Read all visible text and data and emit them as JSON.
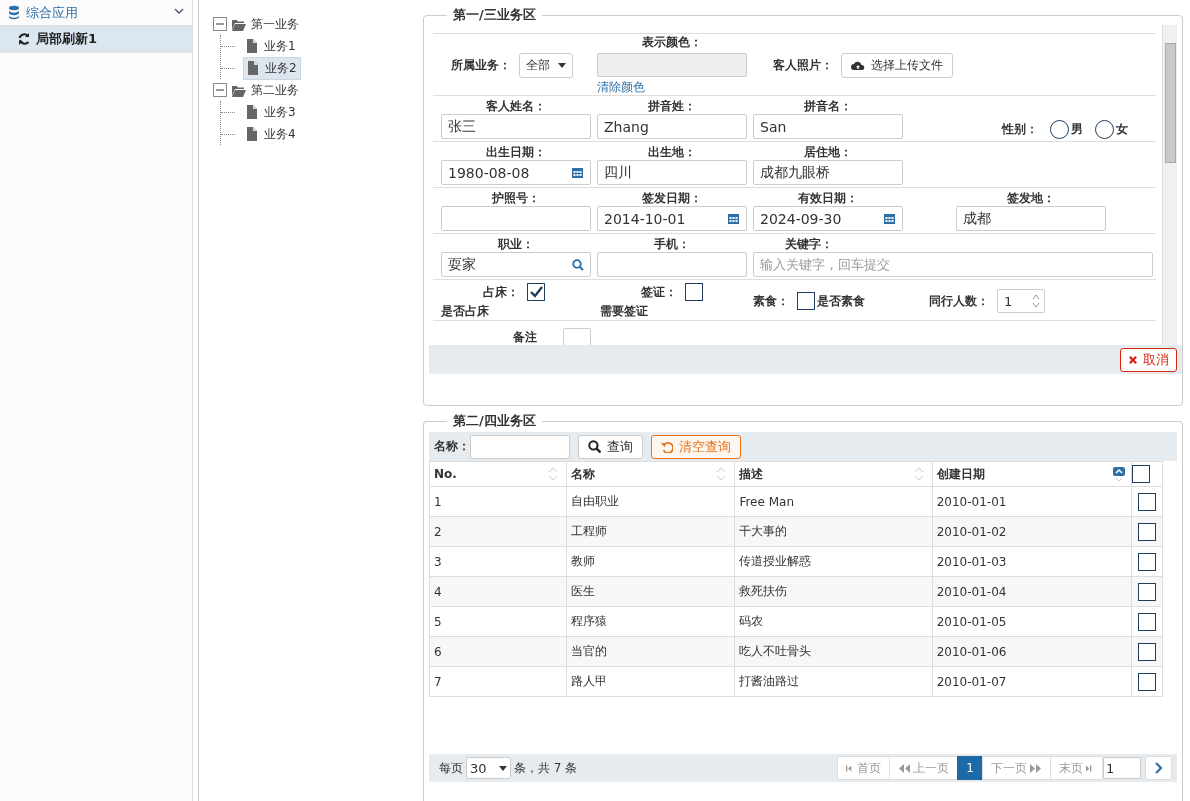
{
  "sidebar": {
    "header": {
      "label": "综合应用",
      "expanded": true
    },
    "items": [
      {
        "label": "局部刷新1",
        "selected": true
      }
    ]
  },
  "tree": [
    {
      "label": "第一业务",
      "expanded": true,
      "children": [
        {
          "label": "业务1",
          "selected": false
        },
        {
          "label": "业务2",
          "selected": true
        }
      ]
    },
    {
      "label": "第二业务",
      "expanded": true,
      "children": [
        {
          "label": "业务3",
          "selected": false
        },
        {
          "label": "业务4",
          "selected": false
        }
      ]
    }
  ],
  "form_panel": {
    "title": "第一/三业务区",
    "rows": [
      [
        {
          "kind": "select",
          "label": "所属业务：",
          "value": "全部"
        },
        {
          "kind": "color",
          "label": "表示颜色：",
          "link": "清除颜色"
        },
        {
          "kind": "file",
          "label": "客人照片：",
          "button": "选择上传文件"
        }
      ],
      [
        {
          "kind": "text",
          "label": "客人姓名：",
          "value": "张三"
        },
        {
          "kind": "text",
          "label": "拼音姓：",
          "value": "Zhang"
        },
        {
          "kind": "text",
          "label": "拼音名：",
          "value": "San"
        },
        {
          "kind": "radio",
          "label": "性别：",
          "options": [
            {
              "label": "男",
              "selected": false
            },
            {
              "label": "女",
              "selected": false
            }
          ]
        }
      ],
      [
        {
          "kind": "date",
          "label": "出生日期：",
          "value": "1980-08-08"
        },
        {
          "kind": "text",
          "label": "出生地：",
          "value": "四川"
        },
        {
          "kind": "text",
          "label": "居住地：",
          "value": "成都九眼桥"
        }
      ],
      [
        {
          "kind": "text",
          "label": "护照号："
        },
        {
          "kind": "date",
          "label": "签发日期：",
          "value": "2014-10-01"
        },
        {
          "kind": "date",
          "label": "有效日期：",
          "value": "2024-09-30"
        },
        {
          "kind": "text",
          "label": "签发地：",
          "value": "成都"
        }
      ],
      [
        {
          "kind": "search",
          "label": "职业：",
          "value": "耍家"
        },
        {
          "kind": "text",
          "label": "手机："
        },
        {
          "kind": "wide",
          "label": "关键字：",
          "placeholder": "输入关键字，回车提交"
        }
      ],
      [
        {
          "kind": "checkbox",
          "label": "占床：",
          "checked": true,
          "caption": "是否占床"
        },
        {
          "kind": "checkbox",
          "label": "签证：",
          "checked": false,
          "caption": "需要签证"
        },
        {
          "kind": "checkbox",
          "label": "素食：",
          "checked": false,
          "text": "是否素食"
        },
        {
          "kind": "spinner",
          "label": "同行人数：",
          "value": "1"
        }
      ],
      [
        {
          "kind": "textarea",
          "label": "备注"
        }
      ]
    ],
    "cancel_button": "取消"
  },
  "grid_panel": {
    "title": "第二/四业务区",
    "search": {
      "label": "名称：",
      "query_button": "查询",
      "clear_button": "清空查询"
    },
    "columns": [
      {
        "label": "No.",
        "sorted": false
      },
      {
        "label": "名称",
        "sorted": false
      },
      {
        "label": "描述",
        "sorted": false
      },
      {
        "label": "创建日期",
        "sorted": true
      }
    ],
    "select_all": false,
    "rows": [
      {
        "cells": [
          "1",
          "自由职业",
          "Free Man",
          "2010-01-01"
        ],
        "checked": false
      },
      {
        "cells": [
          "2",
          "工程师",
          "干大事的",
          "2010-01-02"
        ],
        "checked": false
      },
      {
        "cells": [
          "3",
          "教师",
          "传道授业解惑",
          "2010-01-03"
        ],
        "checked": false
      },
      {
        "cells": [
          "4",
          "医生",
          "救死扶伤",
          "2010-01-04"
        ],
        "checked": false
      },
      {
        "cells": [
          "5",
          "程序猿",
          "码农",
          "2010-01-05"
        ],
        "checked": false
      },
      {
        "cells": [
          "6",
          "当官的",
          "吃人不吐骨头",
          "2010-01-06"
        ],
        "checked": false
      },
      {
        "cells": [
          "7",
          "路人甲",
          "打酱油路过",
          "2010-01-07"
        ],
        "checked": false
      }
    ],
    "pager": {
      "per_page_label": "每页",
      "per_page": "30",
      "total": "条，共 7 条",
      "buttons": [
        {
          "kind": "first",
          "label": "首页",
          "disabled": true
        },
        {
          "kind": "prev",
          "label": "上一页",
          "disabled": true
        },
        {
          "kind": "page",
          "label": "1",
          "selected": true
        },
        {
          "kind": "next",
          "label": "下一页",
          "disabled": true
        },
        {
          "kind": "last",
          "label": "末页",
          "disabled": true
        }
      ],
      "page_input": "1"
    }
  }
}
